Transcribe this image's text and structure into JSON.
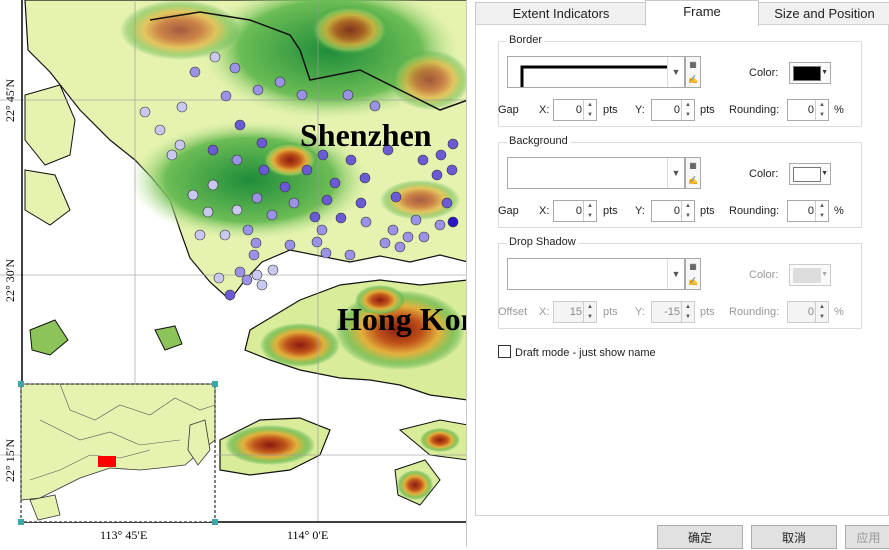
{
  "map": {
    "labels": {
      "shenzhen": "Shenzhen",
      "hongkong": "Hong Kong"
    },
    "lat_labels": [
      "22° 45′N",
      "22° 30′N",
      "22° 15′N"
    ],
    "lon_labels": [
      "113° 45′E",
      "114° 0′E"
    ]
  },
  "tabs": [
    {
      "label": "Extent Indicators"
    },
    {
      "label": "Frame"
    },
    {
      "label": "Size and Position"
    }
  ],
  "border": {
    "title": "Border",
    "color_label": "Color:",
    "color": "#000000",
    "gap_label": "Gap",
    "x_label": "X:",
    "x": "0",
    "pts": "pts",
    "y_label": "Y:",
    "y": "0",
    "rounding_label": "Rounding:",
    "rounding": "0",
    "pct": "%"
  },
  "background": {
    "title": "Background",
    "color_label": "Color:",
    "color": "#ffffff",
    "gap_label": "Gap",
    "x_label": "X:",
    "x": "0",
    "pts": "pts",
    "y_label": "Y:",
    "y": "0",
    "rounding_label": "Rounding:",
    "rounding": "0",
    "pct": "%"
  },
  "shadow": {
    "title": "Drop Shadow",
    "color_label": "Color:",
    "color": "#cccccc",
    "offset_label": "Offset",
    "x_label": "X:",
    "x": "15",
    "pts": "pts",
    "y_label": "Y:",
    "y": "-15",
    "rounding_label": "Rounding:",
    "rounding": "0",
    "pct": "%"
  },
  "draft_mode": {
    "label": "Draft mode - just show name",
    "checked": false
  },
  "buttons": {
    "ok": "确定",
    "cancel": "取消",
    "apply": "应用"
  }
}
